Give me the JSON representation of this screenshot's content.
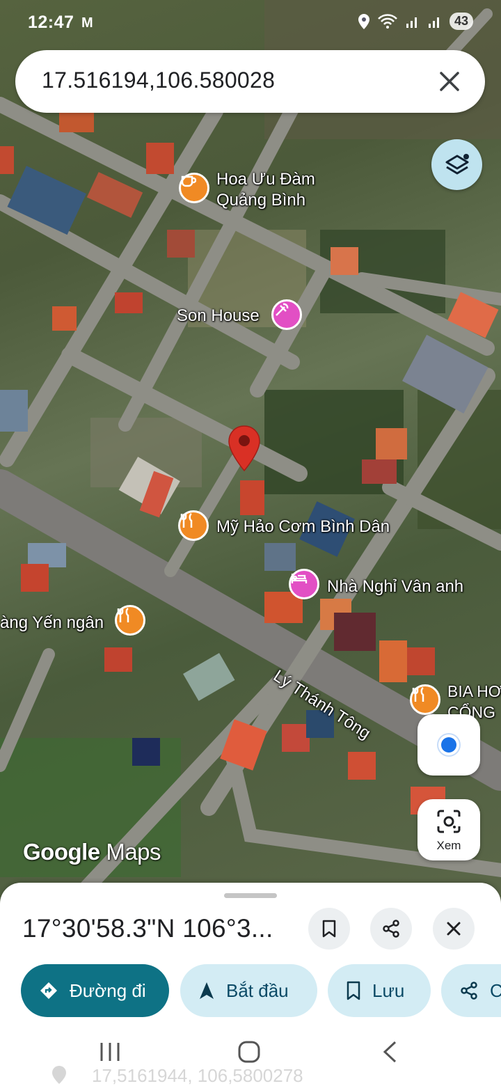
{
  "status_bar": {
    "time": "12:47",
    "mail_icon": "M",
    "battery": "43"
  },
  "search": {
    "value": "17.516194,106.580028"
  },
  "map": {
    "pois": [
      {
        "name_line1": "Hoa Ưu Đàm",
        "name_line2": "Quảng Bình",
        "icon": "cafe-icon"
      },
      {
        "name": "Son House",
        "icon": "salon-icon"
      },
      {
        "name": "Mỹ Hảo Cơm Bình Dân",
        "icon": "restaurant-icon"
      },
      {
        "name": "Nhà Nghỉ Vân anh",
        "icon": "hotel-icon"
      },
      {
        "name": "àng Yến ngân",
        "icon": "restaurant-icon"
      },
      {
        "name_line1": "BIA HƠ",
        "name_line2": "CỔNG",
        "icon": "restaurant-icon"
      }
    ],
    "street": "Lý Thánh Tông",
    "watermark_google": "Google",
    "watermark_maps": "Maps",
    "lens_label": "Xem"
  },
  "sheet": {
    "title": "17°30'58.3\"N 106°3...",
    "chips": [
      {
        "label": "Đường đi",
        "icon": "directions-icon"
      },
      {
        "label": "Bắt đầu",
        "icon": "navigation-arrow-icon"
      },
      {
        "label": "Lưu",
        "icon": "bookmark-icon"
      },
      {
        "label": "C",
        "icon": "share-icon"
      }
    ],
    "ghost_text": "17,5161944, 106,5800278"
  },
  "colors": {
    "primary_chip": "#0e7285",
    "chip_bg": "#d3ecf4",
    "poi_orange": "#f08a24",
    "poi_pink": "#e24fc4",
    "pin_red": "#d93025",
    "location_blue": "#1a73e8"
  }
}
